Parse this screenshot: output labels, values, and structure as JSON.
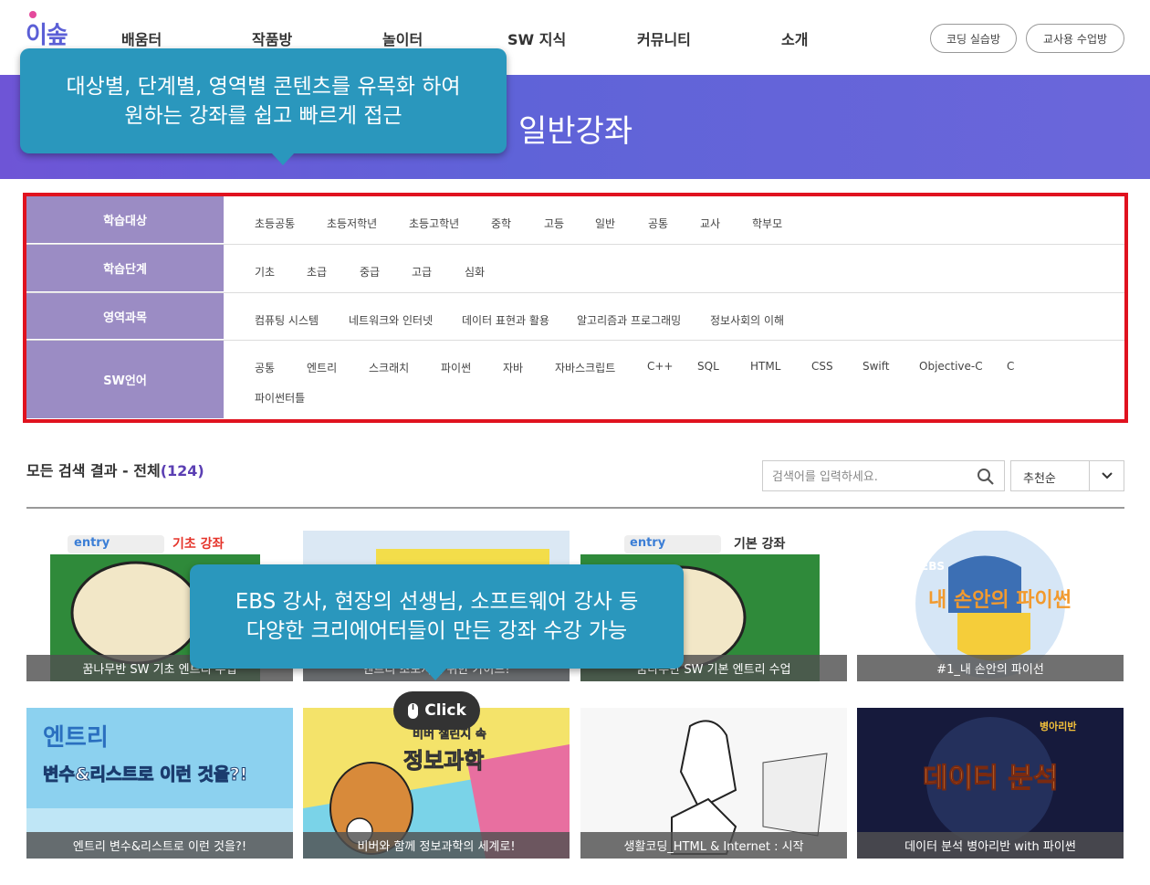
{
  "header": {
    "logo": "이솦",
    "nav": [
      "배움터",
      "작품방",
      "놀이터",
      "SW 지식",
      "커뮤니티",
      "소개"
    ],
    "buttons": [
      "코딩 실습방",
      "교사용 수업방"
    ]
  },
  "banner": {
    "title": "일반강좌"
  },
  "callouts": {
    "top": [
      "대상별, 단계별, 영역별 콘텐츠를 유목화 하여",
      "원하는 강좌를 쉽고 빠르게 접근"
    ],
    "middle": [
      "EBS 강사, 현장의 선생님, 소프트웨어 강사 등",
      "다양한 크리에어터들이 만든 강좌 수강 가능"
    ]
  },
  "filters": [
    {
      "label": "학습대상",
      "items": [
        "초등공통",
        "초등저학년",
        "초등고학년",
        "중학",
        "고등",
        "일반",
        "공통",
        "교사",
        "학부모"
      ]
    },
    {
      "label": "학습단계",
      "items": [
        "기초",
        "초급",
        "중급",
        "고급",
        "심화"
      ]
    },
    {
      "label": "영역과목",
      "items": [
        "컴퓨팅 시스템",
        "네트워크와 인터넷",
        "데이터 표현과 활용",
        "알고리즘과 프로그래밍",
        "정보사회의 이해"
      ]
    },
    {
      "label": "SW언어",
      "items": [
        "공통",
        "엔트리",
        "스크래치",
        "파이썬",
        "자바",
        "자바스크립트",
        "C++",
        "SQL",
        "HTML",
        "CSS",
        "Swift",
        "Objective-C",
        "C",
        "파이썬터틀"
      ]
    }
  ],
  "results": {
    "label": "모든 검색 결과 - 전체",
    "count": "(124)",
    "search_placeholder": "검색어를 입력하세요.",
    "sort_value": "추천순"
  },
  "cards": [
    {
      "caption": "꿈나무반 SW 기초 엔트리 수업",
      "thumb_tag": "기초 강좌",
      "thumb_word": "entry"
    },
    {
      "caption": "엔트리 초보자를 위한 가이드!",
      "thumb_tag": "",
      "thumb_word": ""
    },
    {
      "caption": "꿈나무반 SW 기본 엔트리 수업",
      "thumb_tag": "기본 강좌",
      "thumb_word": "entry"
    },
    {
      "caption": "#1_내 손안의 파이선",
      "thumb_tag": "EBS",
      "thumb_word": "내 손안의 파이썬"
    },
    {
      "caption": "엔트리 변수&리스트로 이런 것을?!",
      "thumb_tag": "엔트리",
      "thumb_word": "변수&리스트로 이런 것을?!"
    },
    {
      "caption": "비버와 함께 정보과학의 세계로!",
      "thumb_tag": "비버 챌린지 속",
      "thumb_word": "정보과학"
    },
    {
      "caption": "생활코딩_HTML & Internet : 시작",
      "thumb_tag": "",
      "thumb_word": ""
    },
    {
      "caption": "데이터 분석 병아리반 with 파이썬",
      "thumb_tag": "병아리반",
      "thumb_word": "데이터 분석"
    }
  ],
  "click_badge": "Click",
  "colors": {
    "accent": "#5b3fb3",
    "banner": "#6358d8",
    "callout": "#2a97bd",
    "filter_label": "#9b8cc4",
    "highlight_border": "#e0121f"
  }
}
